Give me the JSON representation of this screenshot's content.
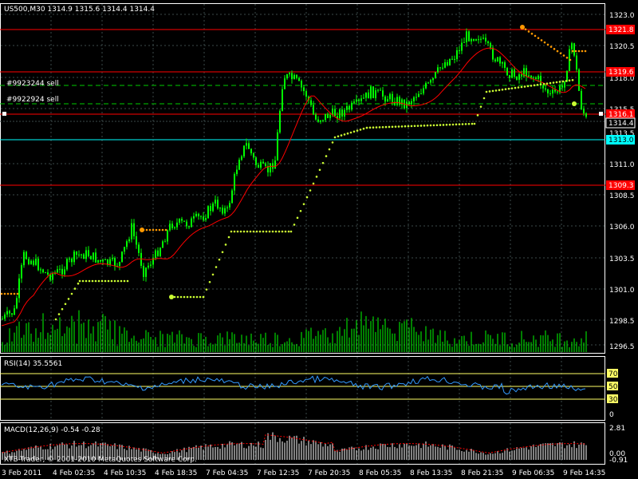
{
  "main": {
    "symbol_header": "US500,M30  1314.9 1315.6 1314.4 1314.4",
    "order_labels": [
      "#9923244 sell",
      "#9922924 sell"
    ],
    "price_ticks": [
      "1323.0",
      "1320.5",
      "1318.0",
      "1315.5",
      "1313.5",
      "1311.0",
      "1308.5",
      "1306.0",
      "1303.5",
      "1301.0",
      "1298.5",
      "1296.5"
    ],
    "level_badges": [
      {
        "text": "1321.8",
        "color": "#ff0000"
      },
      {
        "text": "1319.6",
        "color": "#ff0000"
      },
      {
        "text": "1316.1",
        "color": "#ff0000"
      },
      {
        "text": "1314.4",
        "color": "#000000"
      },
      {
        "text": "1313.0",
        "color": "#00ffff"
      },
      {
        "text": "1309.3",
        "color": "#ff0000"
      }
    ]
  },
  "rsi": {
    "header": "RSI(14) 35.5561",
    "levels": [
      "70",
      "50",
      "30"
    ],
    "zero": "0"
  },
  "macd": {
    "header": "MACD(12,26,9) -0.54 -0.28",
    "ticks": [
      "2.81",
      "0.00",
      "-0.91"
    ]
  },
  "watermark": "XTB-Trader, © 2001-2010 MetaQuotes Software Corp.",
  "time_axis": [
    "3 Feb 2011",
    "4 Feb 02:35",
    "4 Feb 10:35",
    "4 Feb 18:35",
    "7 Feb 04:35",
    "7 Feb 12:35",
    "7 Feb 20:35",
    "8 Feb 05:35",
    "8 Feb 13:35",
    "8 Feb 21:35",
    "9 Feb 06:35",
    "9 Feb 14:35"
  ],
  "colors": {
    "background": "#000000",
    "candles": "#00ff00",
    "grid": "#3c4a4a",
    "moving_average": "#ff0000",
    "trailing_stop": "#ccff33",
    "trailing_stop_orange": "#ff9900",
    "order_line": "#00cc00",
    "level_red": "#ff0000",
    "level_cyan": "#00ffff",
    "rsi_line": "#3399ff",
    "rsi_level": "#ffff66",
    "macd_hist": "#ffffff",
    "macd_signal": "#ff0000",
    "axis_text": "#ffffff"
  }
}
